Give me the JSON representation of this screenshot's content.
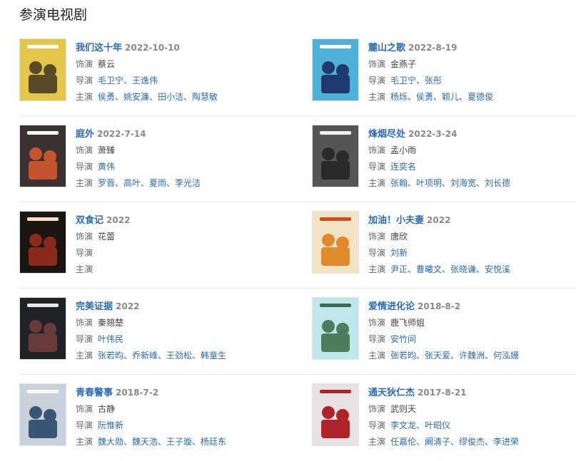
{
  "section_title": "参演电视剧",
  "labels": {
    "role": "饰演",
    "director": "导演",
    "cast": "主演"
  },
  "shows": [
    {
      "title": "我们这十年",
      "date": "2022-10-10",
      "role": "蔡云",
      "directors": "毛卫宁、王逸伟",
      "cast": "侯勇、姚安濂、田小洁、陶慧敏",
      "poster": {
        "bg": "#e3c64a",
        "accent": "#5b4a2a",
        "text": "#ffffff"
      }
    },
    {
      "title": "麓山之歌",
      "date": "2022-8-19",
      "role": "金燕子",
      "directors": "毛卫宁、张彤",
      "cast": "杨烁、侯勇、颖儿、夏德俊",
      "poster": {
        "bg": "#4fb0d8",
        "accent": "#1e3a6e",
        "text": "#ffffff"
      }
    },
    {
      "title": "庭外",
      "date": "2022-7-14",
      "role": "萧臻",
      "directors": "黄伟",
      "cast": "罗晋、高叶、夏雨、李光洁",
      "poster": {
        "bg": "#3a3230",
        "accent": "#c4532e",
        "text": "#ffffff"
      }
    },
    {
      "title": "烽烟尽处",
      "date": "2022-3-24",
      "role": "孟小雨",
      "directors": "连奕名",
      "cast": "张翰、叶项明、刘海宽、刘长德",
      "poster": {
        "bg": "#555555",
        "accent": "#2a2a2a",
        "text": "#f0f0f0"
      }
    },
    {
      "title": "双食记",
      "date": "2022",
      "role": "花蕾",
      "directors": "",
      "cast": "",
      "poster": {
        "bg": "#1a1412",
        "accent": "#8a2a1a",
        "text": "#f3e2c4"
      }
    },
    {
      "title": "加油！小夫妻",
      "date": "2022",
      "role": "唐欣",
      "directors": "刘新",
      "cast": "尹正、曹曦文、张晓谦、安悦溪",
      "poster": {
        "bg": "#f1e3c6",
        "accent": "#e08a2c",
        "text": "#c8511e"
      }
    },
    {
      "title": "完美证据",
      "date": "2022",
      "role": "秦翘楚",
      "directors": "叶伟民",
      "cast": "张若昀、乔新峰、王劲松、韩童生",
      "poster": {
        "bg": "#1f2328",
        "accent": "#6a3a3a",
        "text": "#e8e8e8"
      }
    },
    {
      "title": "爱情进化论",
      "date": "2018-8-2",
      "role": "鹿飞师姐",
      "directors": "安竹间",
      "cast": "张若昀、张天爱、许魏洲、何泓姗",
      "poster": {
        "bg": "#bfe6ea",
        "accent": "#4d7d5a",
        "text": "#3a6a52"
      }
    },
    {
      "title": "青春警事",
      "date": "2018-7-2",
      "role": "古静",
      "directors": "阮惟新",
      "cast": "魏大勋、魏天浩、王子璇、杨廷东",
      "poster": {
        "bg": "#c9d2dc",
        "accent": "#3a5676",
        "text": "#ffffff"
      }
    },
    {
      "title": "通天狄仁杰",
      "date": "2017-8-21",
      "role": "武则天",
      "directors": "李文龙、叶昭仪",
      "cast": "任嘉伦、阚清子、缪俊杰、李进荣",
      "poster": {
        "bg": "#e9e2e4",
        "accent": "#b0232a",
        "text": "#b0232a"
      }
    }
  ]
}
